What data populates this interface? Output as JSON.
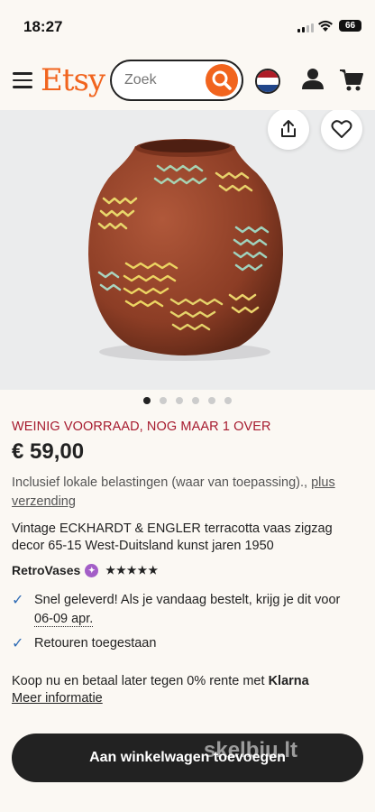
{
  "status_bar": {
    "time": "18:27",
    "battery": "66"
  },
  "header": {
    "logo": "Etsy",
    "search": {
      "placeholder": "Zoek",
      "value": ""
    }
  },
  "gallery": {
    "image_count": 6,
    "active_index": 0
  },
  "listing": {
    "stock_notice": "WEINIG VOORRAAD, NOG MAAR 1 OVER",
    "price": "€ 59,00",
    "tax_text": "Inclusief lokale belastingen (waar van toepassing).,",
    "tax_link_1": "plus",
    "tax_link_2": "verzending",
    "title": "Vintage ECKHARDT & ENGLER terracotta vaas zigzag decor 65-15 West-Duitsland kunst jaren 1950",
    "shop_name": "RetroVases",
    "rating_stars": "★★★★★",
    "delivery_text": "Snel geleverd! Als je vandaag bestelt, krijg je dit voor",
    "delivery_date": "06-09 apr.",
    "returns_text": "Retouren toegestaan",
    "klarna_text": "Koop nu en betaal later tegen 0% rente met",
    "klarna_brand": "Klarna",
    "more_info": "Meer informatie"
  },
  "cta": {
    "add_to_cart": "Aan winkelwagen toevoegen"
  },
  "watermark": "skelbiu.lt",
  "colors": {
    "brand": "#f1641e",
    "stock": "#a61a2e",
    "check": "#2f6cb5",
    "button": "#222222"
  }
}
